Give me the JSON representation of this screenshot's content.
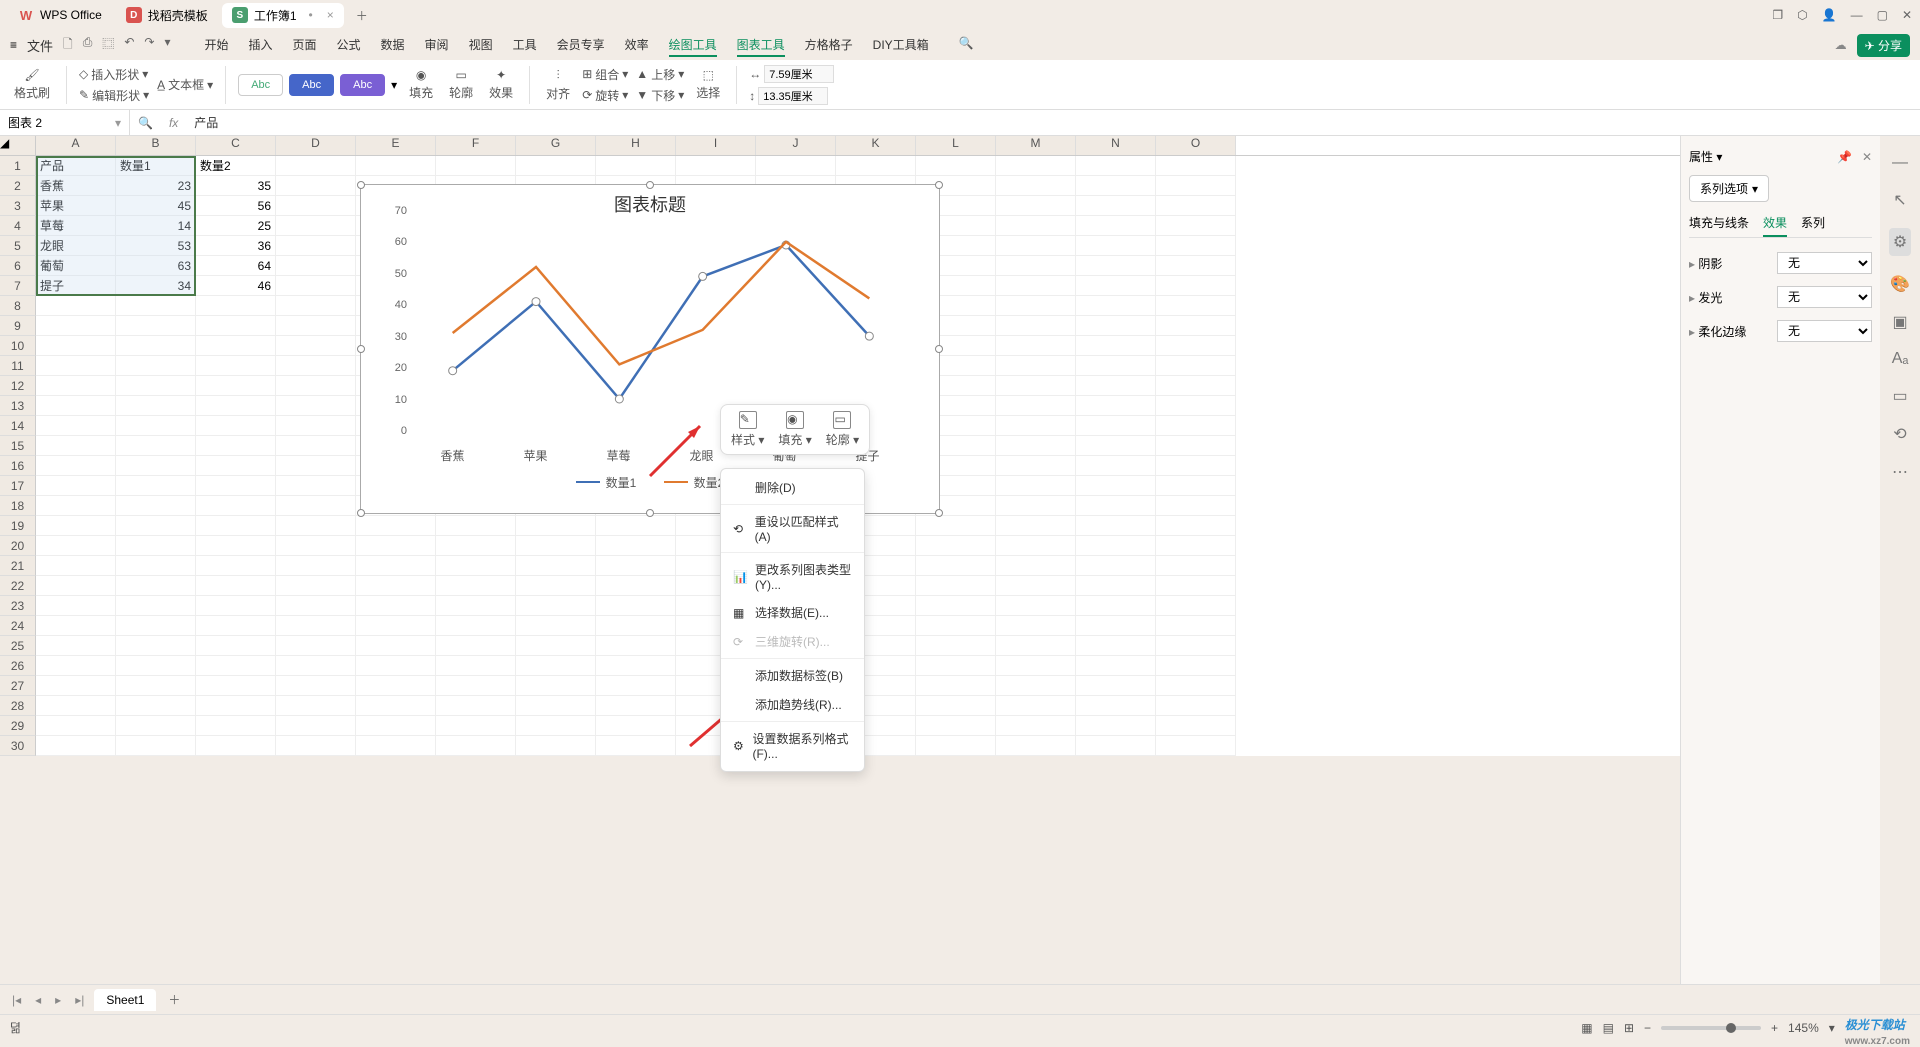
{
  "app": {
    "title": "WPS Office"
  },
  "tabs": [
    {
      "label": "WPS Office",
      "icon": "W"
    },
    {
      "label": "找稻壳模板",
      "icon": "D"
    },
    {
      "label": "工作簿1",
      "icon": "S",
      "active": true
    }
  ],
  "menubar": {
    "file": "文件",
    "tabs": [
      "开始",
      "插入",
      "页面",
      "公式",
      "数据",
      "审阅",
      "视图",
      "工具",
      "会员专享",
      "效率",
      "绘图工具",
      "图表工具",
      "方格格子",
      "DIY工具箱"
    ],
    "active_indices": [
      10,
      11
    ],
    "share": "分享"
  },
  "ribbon": {
    "format_painter": "格式刷",
    "insert_shape": "插入形状",
    "text_box": "文本框",
    "edit_shape": "编辑形状",
    "abc": "Abc",
    "fill": "填充",
    "outline": "轮廓",
    "effect": "效果",
    "align": "对齐",
    "group": "组合",
    "rotate": "旋转",
    "up": "上移",
    "down": "下移",
    "select": "选择",
    "width": "7.59厘米",
    "height": "13.35厘米"
  },
  "name_box": "图表 2",
  "formula": {
    "fx": "fx",
    "value": "产品"
  },
  "columns": [
    "A",
    "B",
    "C",
    "D",
    "E",
    "F",
    "G",
    "H",
    "I",
    "J",
    "K",
    "L",
    "M",
    "N",
    "O"
  ],
  "rows": 30,
  "sheet_data": {
    "headers": [
      "产品",
      "数量1",
      "数量2"
    ],
    "rows": [
      [
        "香蕉",
        23,
        35
      ],
      [
        "苹果",
        45,
        56
      ],
      [
        "草莓",
        14,
        25
      ],
      [
        "龙眼",
        53,
        36
      ],
      [
        "葡萄",
        63,
        64
      ],
      [
        "提子",
        34,
        46
      ]
    ]
  },
  "chart_data": {
    "type": "line",
    "title": "图表标题",
    "categories": [
      "香蕉",
      "苹果",
      "草莓",
      "龙眼",
      "葡萄",
      "提子"
    ],
    "series": [
      {
        "name": "数量1",
        "color": "#3f6fb5",
        "values": [
          23,
          45,
          14,
          53,
          63,
          34
        ]
      },
      {
        "name": "数量2",
        "color": "#e07a2f",
        "values": [
          35,
          56,
          25,
          36,
          64,
          46
        ]
      }
    ],
    "ylim": [
      0,
      70
    ],
    "yticks": [
      0,
      10,
      20,
      30,
      40,
      50,
      60,
      70
    ]
  },
  "mini_toolbar": {
    "style": "样式",
    "fill": "填充",
    "outline": "轮廓"
  },
  "context_menu": {
    "delete": "删除(D)",
    "reset": "重设以匹配样式(A)",
    "change_type": "更改系列图表类型(Y)...",
    "select_data": "选择数据(E)...",
    "rotate3d": "三维旋转(R)...",
    "add_labels": "添加数据标签(B)",
    "add_trend": "添加趋势线(R)...",
    "format_series": "设置数据系列格式(F)..."
  },
  "properties": {
    "title": "属性",
    "series_options": "系列选项",
    "tabs": [
      "填充与线条",
      "效果",
      "系列"
    ],
    "active_tab": 1,
    "shadow": "阴影",
    "glow": "发光",
    "soft_edge": "柔化边缘",
    "none": "无"
  },
  "sheet_tab": "Sheet1",
  "status": {
    "ready": "뎖",
    "zoom": "145%"
  },
  "watermark": {
    "brand": "极光下载站",
    "url": "www.xz7.com"
  },
  "down_arrow": "▾"
}
